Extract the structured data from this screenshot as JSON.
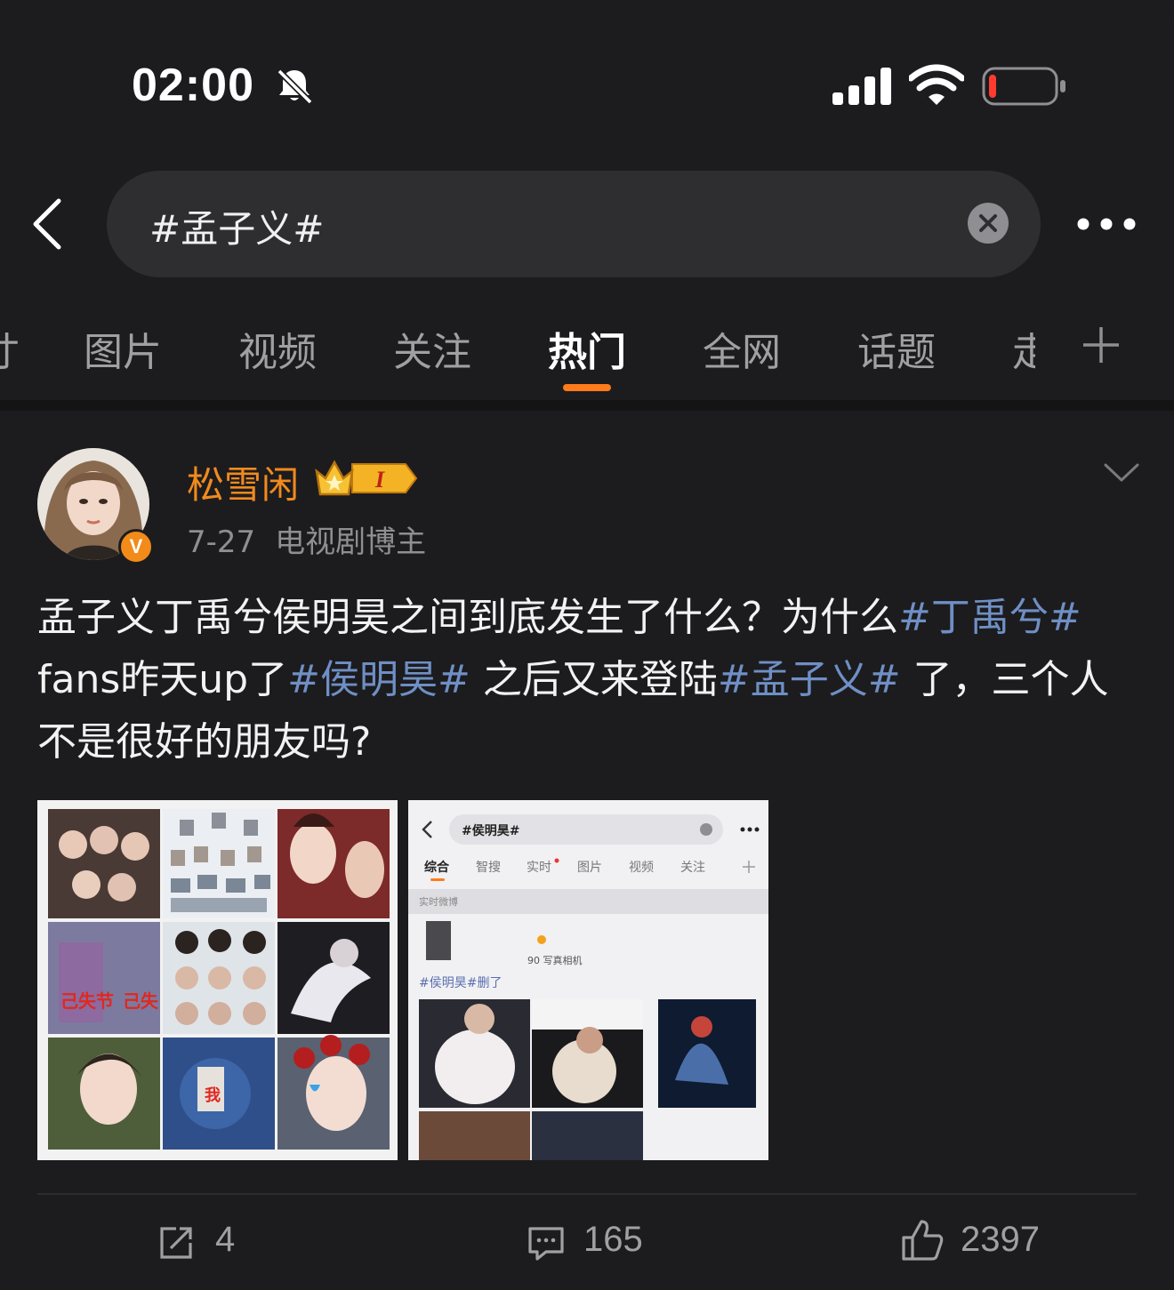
{
  "status_bar": {
    "time": "02:00",
    "icons": [
      "bell-slash-icon",
      "cellular-signal-icon",
      "wifi-icon",
      "battery-low-icon"
    ],
    "battery_color": "#ff3b30"
  },
  "search": {
    "query": "#孟子义#"
  },
  "tabs": [
    {
      "label": "图片",
      "active": false
    },
    {
      "label": "视频",
      "active": false
    },
    {
      "label": "关注",
      "active": false
    },
    {
      "label": "热门",
      "active": true
    },
    {
      "label": "全网",
      "active": false
    },
    {
      "label": "话题",
      "active": false
    },
    {
      "label": "走",
      "active": false
    }
  ],
  "tab_partial_left": "寸",
  "accent_color": "#ff7b1c",
  "post": {
    "username": "松雪闲",
    "username_color": "#f18a1e",
    "level_badge": "I",
    "verified_mark": "V",
    "date": "7-27",
    "category": "电视剧博主",
    "text_segments": [
      {
        "text": "孟子义丁禹兮侯明昊之间到底发生了什么？为什么",
        "topic": false
      },
      {
        "text": "#丁禹兮#",
        "topic": true
      },
      {
        "text": " fans昨天up了",
        "topic": false
      },
      {
        "text": "#侯明昊#",
        "topic": true
      },
      {
        "text": " 之后又来登陆",
        "topic": false
      },
      {
        "text": "#孟子义#",
        "topic": true
      },
      {
        "text": " 了，三个人不是很好的朋友吗?",
        "topic": false
      }
    ],
    "topic_color": "#6f8fc5",
    "image2": {
      "search": "#侯明昊#",
      "tabs": [
        "综合",
        "智搜",
        "实时",
        "图片",
        "视频",
        "关注"
      ],
      "section": "实时微博",
      "meta": "90 写真相机",
      "text": "#侯明昊#删了"
    },
    "actions": {
      "repost": "4",
      "comment": "165",
      "like": "2397"
    }
  }
}
